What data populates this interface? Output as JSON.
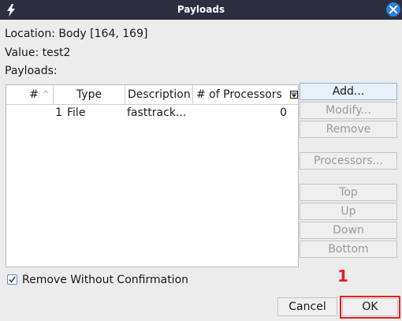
{
  "window": {
    "title": "Payloads",
    "app_icon": "burp-lightning-icon",
    "close_icon": "close-icon"
  },
  "info": {
    "location": "Location: Body [164, 169]",
    "value": "Value: test2",
    "payloads_label": "Payloads:"
  },
  "table": {
    "columns": [
      "#",
      "Type",
      "Description",
      "# of Processors"
    ],
    "sort_indicator": "^",
    "rows": [
      {
        "num": "1",
        "type": "File",
        "description": "fasttrack...",
        "processors": "0"
      }
    ]
  },
  "buttons": {
    "add": "Add...",
    "modify": "Modify...",
    "remove": "Remove",
    "processors": "Processors...",
    "top": "Top",
    "up": "Up",
    "down": "Down",
    "bottom": "Bottom"
  },
  "options": {
    "remove_without_confirmation": "Remove Without Confirmation",
    "remove_without_confirmation_checked": true
  },
  "dialog": {
    "cancel": "Cancel",
    "ok": "OK"
  },
  "annotation": {
    "marker": "1",
    "color": "#e02020"
  },
  "colors": {
    "titlebar": "#2b2f3f",
    "accent": "#2f7fe0"
  }
}
